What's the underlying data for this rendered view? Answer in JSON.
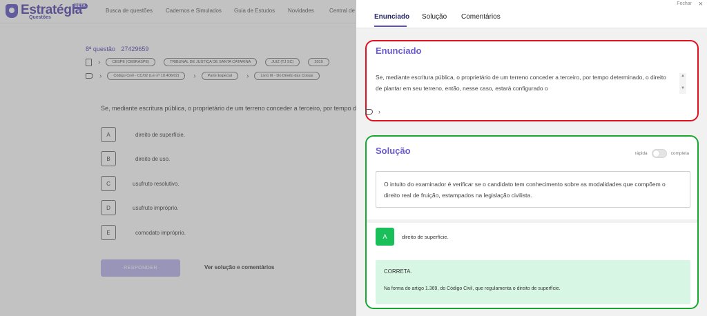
{
  "brand": {
    "name": "Estratégia",
    "sub": "Questões",
    "beta": "BETA"
  },
  "nav": [
    "Busca de questões",
    "Cadernos e Simulados",
    "Guia de Estudos",
    "Novidades",
    "Central de"
  ],
  "question": {
    "number": "8ª questão",
    "id": "27429659",
    "meta1": [
      "CESPE (CEBRASPE)",
      "TRIBUNAL DE JUSTIÇA DE SANTA CATARINA",
      "JUIZ (TJ SC)",
      "2019"
    ],
    "meta2": [
      "Código Civil - CC/02 (Lei nº 10.406/02)",
      "Parte Especial",
      "Livro III - Do Direito das Coisas"
    ],
    "text": "Se, mediante escritura pública, o proprietário de um terreno conceder a terceiro, por tempo de",
    "options": [
      {
        "letter": "A",
        "text": "direito de superfície."
      },
      {
        "letter": "B",
        "text": "direito de uso."
      },
      {
        "letter": "C",
        "text": "usufruto resolutivo."
      },
      {
        "letter": "D",
        "text": "usufruto impróprio."
      },
      {
        "letter": "E",
        "text": "comodato impróprio."
      }
    ],
    "answer_button": "RESPONDER",
    "view_solution": "Ver solução e comentários"
  },
  "panel": {
    "tabs": [
      "Enunciado",
      "Solução",
      "Comentários"
    ],
    "close_label": "Fechar",
    "close_icon": "×",
    "enunciado": {
      "title": "Enunciado",
      "text": "Se, mediante escritura pública, o proprietário de um terreno conceder a terceiro, por tempo determinado, o direito de plantar em seu terreno, então, nesse caso, estará configurado o"
    },
    "solucao": {
      "title": "Solução",
      "toggle_left": "rápida",
      "toggle_right": "completa",
      "text": "O intuito do examinador é verificar se o candidato tem conhecimento sobre as modalidades que compõem o direito real de fruição, estampados na legislação civilista.",
      "answer_letter": "A",
      "answer_text": "direito de superfície.",
      "correct_title": "CORRETA.",
      "correct_text": "Na forma do artigo 1.369, do Código Civil, que regulamenta o direito de superfície."
    }
  },
  "colors": {
    "brand": "#5b4fc0",
    "highlight_red": "#e0101e",
    "highlight_green": "#16a82e",
    "answer_green": "#19c05a",
    "correct_bg": "#d7f7e4"
  }
}
